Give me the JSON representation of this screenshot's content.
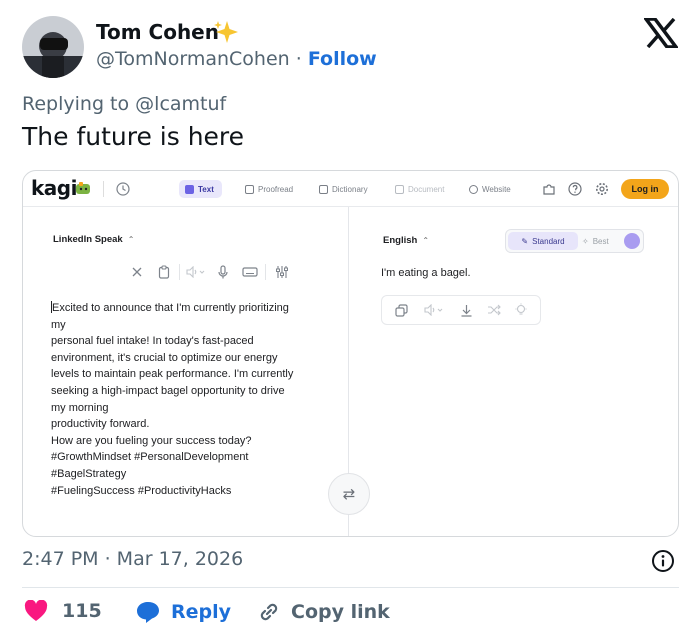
{
  "tweet": {
    "author_name": "Tom Cohen",
    "author_emoji": "sparkles",
    "handle": "@TomNormanCohen",
    "separator": "·",
    "follow_label": "Follow",
    "replying_to_prefix": "Replying to",
    "replying_to_handle": "@lcamtuf",
    "text": "The future is here",
    "timestamp": "2:47 PM · Mar 17, 2026",
    "like_count": "115",
    "reply_label": "Reply",
    "copy_link_label": "Copy link",
    "colors": {
      "like": "#f91880",
      "link": "#1d6fd8",
      "muted": "#536471"
    }
  },
  "screenshot": {
    "logo": "kagi",
    "tabs": [
      {
        "label": "Text",
        "icon": "chat-icon",
        "active": true
      },
      {
        "label": "Proofread",
        "icon": "proofread-icon",
        "active": false
      },
      {
        "label": "Dictionary",
        "icon": "book-icon",
        "active": false
      },
      {
        "label": "Document",
        "icon": "document-icon",
        "active": false,
        "disabled": true
      },
      {
        "label": "Website",
        "icon": "globe-icon",
        "active": false
      }
    ],
    "login_label": "Log in",
    "source_language": "LinkedIn Speak",
    "target_language": "English",
    "source_lines": [
      "Excited to announce that I'm currently prioritizing",
      "my",
      "personal fuel intake! In today's fast-paced",
      "environment, it's crucial to optimize our energy",
      "levels to maintain peak performance. I'm currently",
      "seeking a high-impact bagel opportunity to drive",
      "my morning",
      "productivity forward.",
      "How are you fueling your success today?",
      "#GrowthMindset #PersonalDevelopment",
      "#BagelStrategy",
      "#FuelingSuccess #ProductivityHacks"
    ],
    "result_text": "I'm eating a bagel.",
    "modes": {
      "standard": "Standard",
      "best": "Best"
    },
    "accent_color": "#6c63e4",
    "login_color": "#f3a51a"
  }
}
